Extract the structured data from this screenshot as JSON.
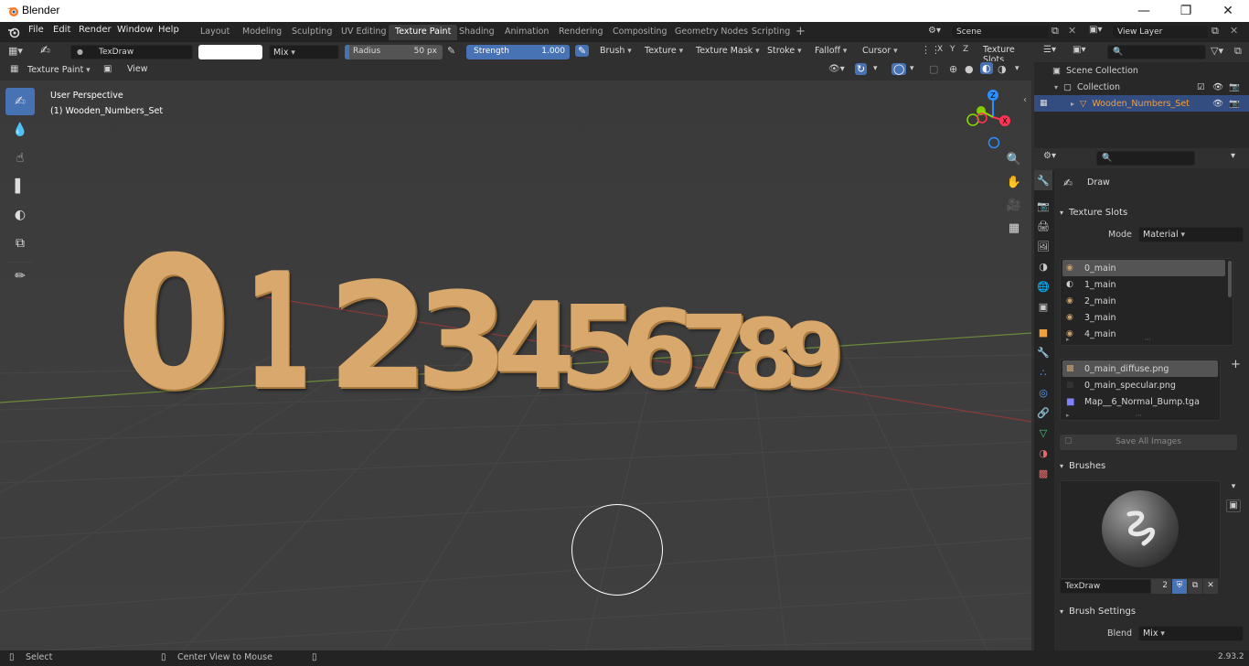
{
  "app": {
    "title": "Blender",
    "version": "2.93.2"
  },
  "menu": [
    "File",
    "Edit",
    "Render",
    "Window",
    "Help"
  ],
  "workspaces": [
    "Layout",
    "Modeling",
    "Sculpting",
    "UV Editing",
    "Texture Paint",
    "Shading",
    "Animation",
    "Rendering",
    "Compositing",
    "Geometry Nodes",
    "Scripting"
  ],
  "active_workspace": "Texture Paint",
  "scene": {
    "name": "Scene",
    "view_layer": "View Layer"
  },
  "tool_header": {
    "brush_name": "TexDraw",
    "blend": "Mix",
    "radius_label": "Radius",
    "radius_value": "50 px",
    "strength_label": "Strength",
    "strength_value": "1.000",
    "menus": [
      "Brush",
      "Texture",
      "Texture Mask",
      "Stroke",
      "Falloff",
      "Cursor"
    ],
    "axes": [
      "X",
      "Y",
      "Z"
    ],
    "texture_slots": "Texture Slots"
  },
  "view_header": {
    "mode": "Texture Paint",
    "view": "View"
  },
  "viewport": {
    "perspective": "User Perspective",
    "object": "(1) Wooden_Numbers_Set",
    "digits": [
      "0",
      "1",
      "2",
      "3",
      "4",
      "5",
      "6",
      "7",
      "8",
      "9"
    ]
  },
  "gizmo": {
    "x": "X",
    "y": "Y",
    "z": "Z"
  },
  "outliner": {
    "scene_collection": "Scene Collection",
    "collection": "Collection",
    "object": "Wooden_Numbers_Set"
  },
  "properties": {
    "tool_name": "Draw",
    "texture_slots_title": "Texture Slots",
    "mode_label": "Mode",
    "mode_value": "Material",
    "slots": [
      "0_main",
      "1_main",
      "2_main",
      "3_main",
      "4_main"
    ],
    "images": [
      "0_main_diffuse.png",
      "0_main_specular.png",
      "Map__6_Normal_Bump.tga"
    ],
    "save_all": "Save All Images",
    "brushes_title": "Brushes",
    "brush_name": "TexDraw",
    "brush_users": "2",
    "brush_settings_title": "Brush Settings",
    "blend_label": "Blend",
    "blend_value": "Mix"
  },
  "status": {
    "select": "Select",
    "center": "Center View to Mouse"
  },
  "colors": {
    "accent": "#4772b3",
    "wood": "#d4a46a",
    "object_orange": "#f0a040"
  }
}
